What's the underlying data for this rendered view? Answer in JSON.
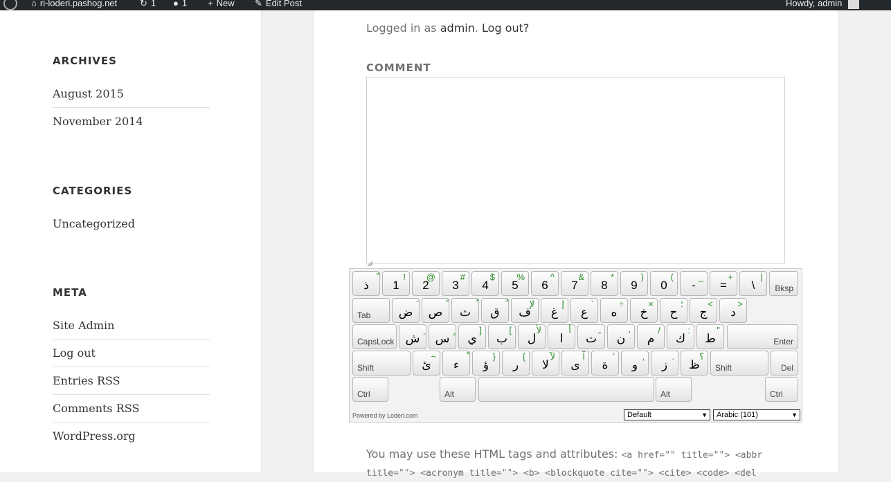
{
  "admin_bar": {
    "site_name": "ri-loderi.pashog.net",
    "updates_count": "1",
    "comments_count": "1",
    "new_label": "New",
    "edit_post_label": "Edit Post",
    "howdy_label": "Howdy, admin"
  },
  "sidebar": {
    "archives_title": "ARCHIVES",
    "archives": [
      "August 2015",
      "November 2014"
    ],
    "categories_title": "CATEGORIES",
    "categories": [
      "Uncategorized"
    ],
    "meta_title": "META",
    "meta": [
      "Site Admin",
      "Log out",
      "Entries RSS",
      "Comments RSS",
      "WordPress.org"
    ]
  },
  "comment_form": {
    "logged_in_prefix": "Logged in as",
    "user_link": "admin",
    "logout_link": "Log out?",
    "comment_label": "COMMENT",
    "comment_value": "",
    "allowed_tags_text": "You may use these HTML tags and attributes:",
    "allowed_tags_code": "<a href=\"\" title=\"\"> <abbr title=\"\"> <acronym title=\"\"> <b> <blockquote cite=\"\"> <cite> <code> <del"
  },
  "keyboard": {
    "rows": [
      [
        {
          "main": "ذ",
          "shift": "ّ"
        },
        {
          "main": "1",
          "shift": "!"
        },
        {
          "main": "2",
          "shift": "@"
        },
        {
          "main": "3",
          "shift": "#"
        },
        {
          "main": "4",
          "shift": "$"
        },
        {
          "main": "5",
          "shift": "%"
        },
        {
          "main": "6",
          "shift": "^"
        },
        {
          "main": "7",
          "shift": "&"
        },
        {
          "main": "8",
          "shift": "*"
        },
        {
          "main": "9",
          "shift": ")"
        },
        {
          "main": "0",
          "shift": "("
        },
        {
          "main": "-",
          "shift": "_"
        },
        {
          "main": "=",
          "shift": "+"
        },
        {
          "main": "\\",
          "shift": "|"
        },
        {
          "label": "Bksp"
        }
      ],
      [
        {
          "label": "Tab"
        },
        {
          "main": "ض",
          "shift": "َ"
        },
        {
          "main": "ص",
          "shift": "ً"
        },
        {
          "main": "ث",
          "shift": "ُ"
        },
        {
          "main": "ق",
          "shift": "ٌ"
        },
        {
          "main": "ف",
          "shift": "لإ"
        },
        {
          "main": "غ",
          "shift": "إ"
        },
        {
          "main": "ع",
          "shift": "`"
        },
        {
          "main": "ه",
          "shift": "÷"
        },
        {
          "main": "خ",
          "shift": "×"
        },
        {
          "main": "ح",
          "shift": "؛"
        },
        {
          "main": "ج",
          "shift": "<"
        },
        {
          "main": "د",
          "shift": ">"
        }
      ],
      [
        {
          "label": "CapsLock"
        },
        {
          "main": "ش",
          "shift": "ِ"
        },
        {
          "main": "س",
          "shift": "ٍ"
        },
        {
          "main": "ي",
          "shift": "]"
        },
        {
          "main": "ب",
          "shift": "["
        },
        {
          "main": "ل",
          "shift": "لأ"
        },
        {
          "main": "ا",
          "shift": "أ"
        },
        {
          "main": "ت",
          "shift": "ـ"
        },
        {
          "main": "ن",
          "shift": "،"
        },
        {
          "main": "م",
          "shift": "/"
        },
        {
          "main": "ك",
          "shift": ":"
        },
        {
          "main": "ط",
          "shift": "\""
        },
        {
          "label": "Enter"
        }
      ],
      [
        {
          "label": "Shift"
        },
        {
          "main": "ئ",
          "shift": "~"
        },
        {
          "main": "ء",
          "shift": "ْ"
        },
        {
          "main": "ؤ",
          "shift": "}"
        },
        {
          "main": "ر",
          "shift": "{"
        },
        {
          "main": "لا",
          "shift": "لآ"
        },
        {
          "main": "ى",
          "shift": "آ"
        },
        {
          "main": "ة",
          "shift": "’"
        },
        {
          "main": "و",
          "shift": ","
        },
        {
          "main": "ز",
          "shift": "."
        },
        {
          "main": "ظ",
          "shift": "؟"
        },
        {
          "label": "Shift"
        },
        {
          "label": "Del"
        }
      ],
      [
        {
          "label": "Ctrl"
        },
        {
          "label": "Alt"
        },
        {
          "label": ""
        },
        {
          "label": "Alt"
        },
        {
          "label": "Ctrl"
        }
      ]
    ],
    "powered_by": "Powered by Loderi.com",
    "layout_select": "Default",
    "language_select": "Arabic (101)"
  }
}
